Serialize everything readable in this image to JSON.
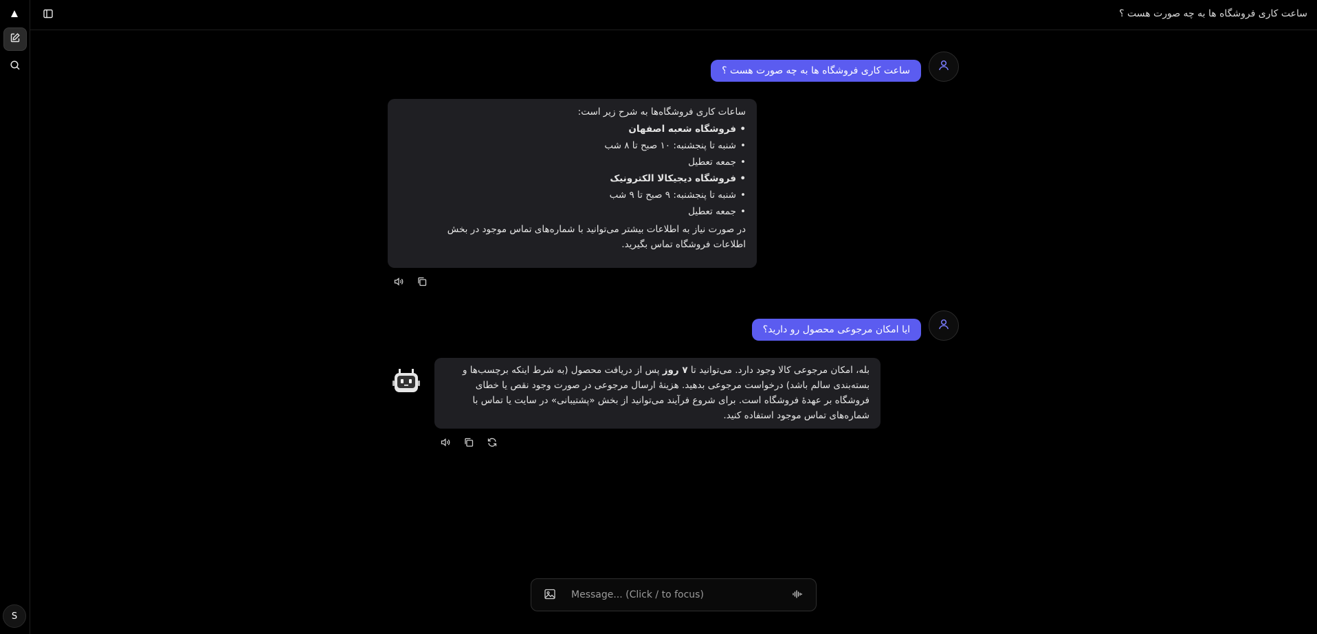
{
  "header": {
    "title": "ساعت کاری فروشگاه ها به چه صورت هست ؟"
  },
  "sidebar": {
    "avatar_initial": "S"
  },
  "messages": {
    "user1": "ساعت کاری فروشگاه ها به چه صورت هست ؟",
    "bot1": {
      "intro": "ساعات کاری فروشگاه‌ها به شرح زیر است:",
      "items": [
        {
          "text": "فروشگاه شعبه اصفهان",
          "bold": true
        },
        {
          "text": "شنبه تا پنجشنبه: ۱۰ صبح تا ۸ شب",
          "bold": false
        },
        {
          "text": "جمعه تعطیل",
          "bold": false
        },
        {
          "text": "فروشگاه دیجیکالا الکترونیک",
          "bold": true
        },
        {
          "text": "شنبه تا پنجشنبه: ۹ صبح تا ۹ شب",
          "bold": false
        },
        {
          "text": "جمعه تعطیل",
          "bold": false
        }
      ],
      "outro": "در صورت نیاز به اطلاعات بیشتر می‌توانید با شماره‌های تماس موجود در بخش اطلاعات فروشگاه تماس بگیرید."
    },
    "user2": "ایا امکان مرجوعی محصول رو دارید؟",
    "bot2": {
      "part1": "بله، امکان مرجوعی کالا وجود دارد. می‌توانید تا ",
      "bold": "۷ روز",
      "part2": " پس از دریافت محصول (به شرط اینکه برچسب‌ها و بسته‌بندی سالم باشد) درخواست مرجوعی بدهید. هزینهٔ ارسال مرجوعی در صورت وجود نقص یا خطای فروشگاه بر عهدهٔ فروشگاه است. برای شروع فرآیند می‌توانید از بخش «پشتیبانی» در سایت یا تماس با شماره‌های تماس موجود استفاده کنید."
    }
  },
  "composer": {
    "placeholder": "Message... (Click / to focus)"
  },
  "icons": {
    "logo": "triangle-logo-icon",
    "new_chat": "new-chat-icon",
    "search": "search-icon",
    "sidebar_toggle": "sidebar-toggle-icon",
    "speaker": "speaker-icon",
    "copy": "copy-icon",
    "regenerate": "regenerate-icon",
    "image": "image-icon",
    "voice": "voice-wave-icon"
  },
  "colors": {
    "accent": "#5b5cf0",
    "background": "#000000",
    "bubble": "#1f1f23"
  }
}
